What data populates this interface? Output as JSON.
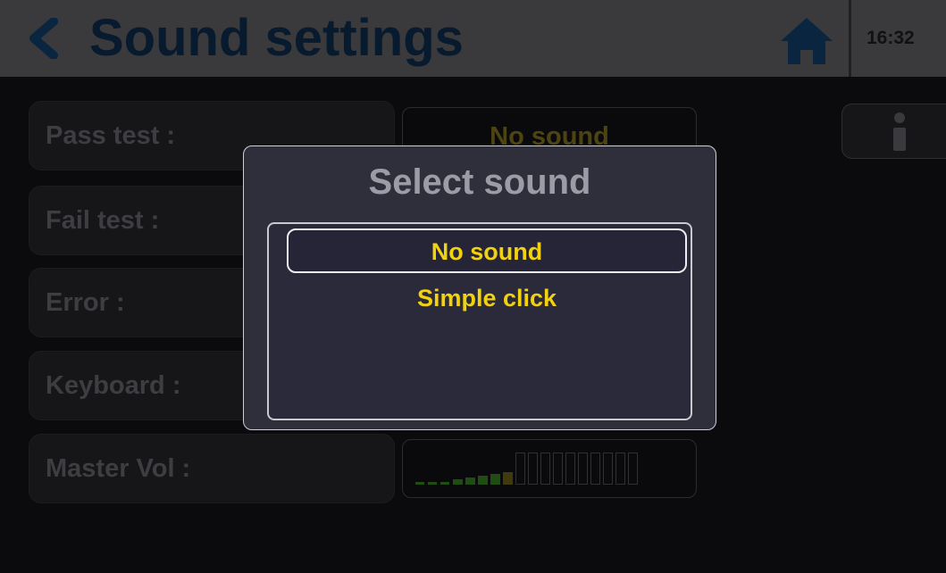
{
  "header": {
    "title": "Sound settings",
    "time": "16:32"
  },
  "settings": {
    "rows": [
      {
        "label": "Pass test :",
        "value": "No sound"
      },
      {
        "label": "Fail test :",
        "value": ""
      },
      {
        "label": "Error :",
        "value": ""
      },
      {
        "label": "Keyboard :",
        "value": ""
      },
      {
        "label": "Master Vol :",
        "value": ""
      }
    ],
    "master_volume": {
      "level": 5,
      "total": 15
    }
  },
  "dialog": {
    "title": "Select sound",
    "options": [
      "No sound",
      "Simple click"
    ],
    "selected_index": 0
  },
  "icons": {
    "back": "chevron-left-icon",
    "home": "home-icon",
    "info": "info-icon"
  },
  "colors": {
    "accent_text": "#f2d10f",
    "back_chevron": "#0f3a66",
    "home_icon": "#0f3a66",
    "volume_on": "#2e7d1a"
  }
}
